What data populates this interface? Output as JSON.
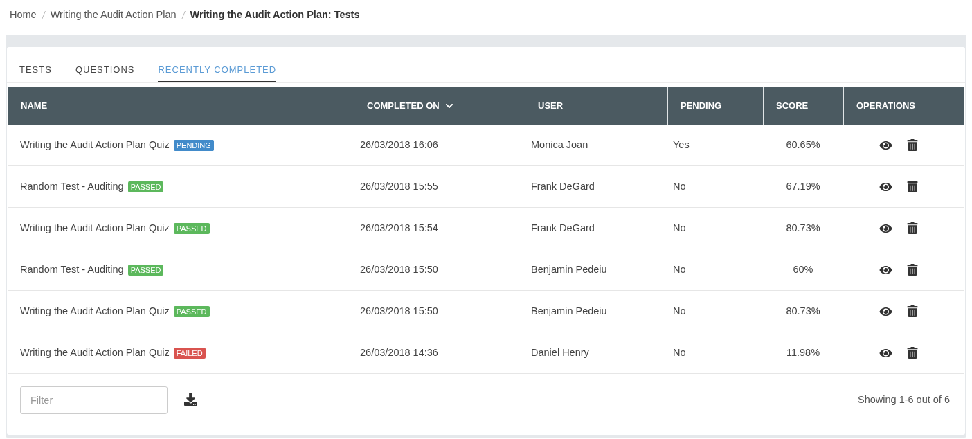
{
  "breadcrumb": [
    {
      "label": "Home",
      "current": false
    },
    {
      "label": "Writing the Audit Action Plan",
      "current": false
    },
    {
      "label": "Writing the Audit Action Plan: Tests",
      "current": true
    }
  ],
  "tabs": [
    {
      "label": "TESTS",
      "selected": false
    },
    {
      "label": "QUESTIONS",
      "selected": false
    },
    {
      "label": "RECENTLY COMPLETED",
      "selected": true
    }
  ],
  "table": {
    "columns": [
      {
        "label": "NAME",
        "sorted": false
      },
      {
        "label": "COMPLETED ON",
        "sorted": true
      },
      {
        "label": "USER",
        "sorted": false
      },
      {
        "label": "PENDING",
        "sorted": false
      },
      {
        "label": "SCORE",
        "sorted": false
      },
      {
        "label": "OPERATIONS",
        "sorted": false
      }
    ],
    "rows": [
      {
        "name": "Writing the Audit Action Plan Quiz",
        "status": {
          "label": "PENDING",
          "color": "#428bca"
        },
        "completed_on": "26/03/2018 16:06",
        "user": "Monica Joan",
        "pending": "Yes",
        "score": "60.65%"
      },
      {
        "name": "Random Test - Auditing",
        "status": {
          "label": "PASSED",
          "color": "#5cb85c"
        },
        "completed_on": "26/03/2018 15:55",
        "user": "Frank DeGard",
        "pending": "No",
        "score": "67.19%"
      },
      {
        "name": "Writing the Audit Action Plan Quiz",
        "status": {
          "label": "PASSED",
          "color": "#5cb85c"
        },
        "completed_on": "26/03/2018 15:54",
        "user": "Frank DeGard",
        "pending": "No",
        "score": "80.73%"
      },
      {
        "name": "Random Test - Auditing",
        "status": {
          "label": "PASSED",
          "color": "#5cb85c"
        },
        "completed_on": "26/03/2018 15:50",
        "user": "Benjamin Pedeiu",
        "pending": "No",
        "score": "60%"
      },
      {
        "name": "Writing the Audit Action Plan Quiz",
        "status": {
          "label": "PASSED",
          "color": "#5cb85c"
        },
        "completed_on": "26/03/2018 15:50",
        "user": "Benjamin Pedeiu",
        "pending": "No",
        "score": "80.73%"
      },
      {
        "name": "Writing the Audit Action Plan Quiz",
        "status": {
          "label": "FAILED",
          "color": "#d9534f"
        },
        "completed_on": "26/03/2018 14:36",
        "user": "Daniel Henry",
        "pending": "No",
        "score": "11.98%"
      }
    ]
  },
  "footer": {
    "filter": {
      "placeholder": "Filter"
    },
    "summary": "Showing 1-6 out of 6"
  }
}
